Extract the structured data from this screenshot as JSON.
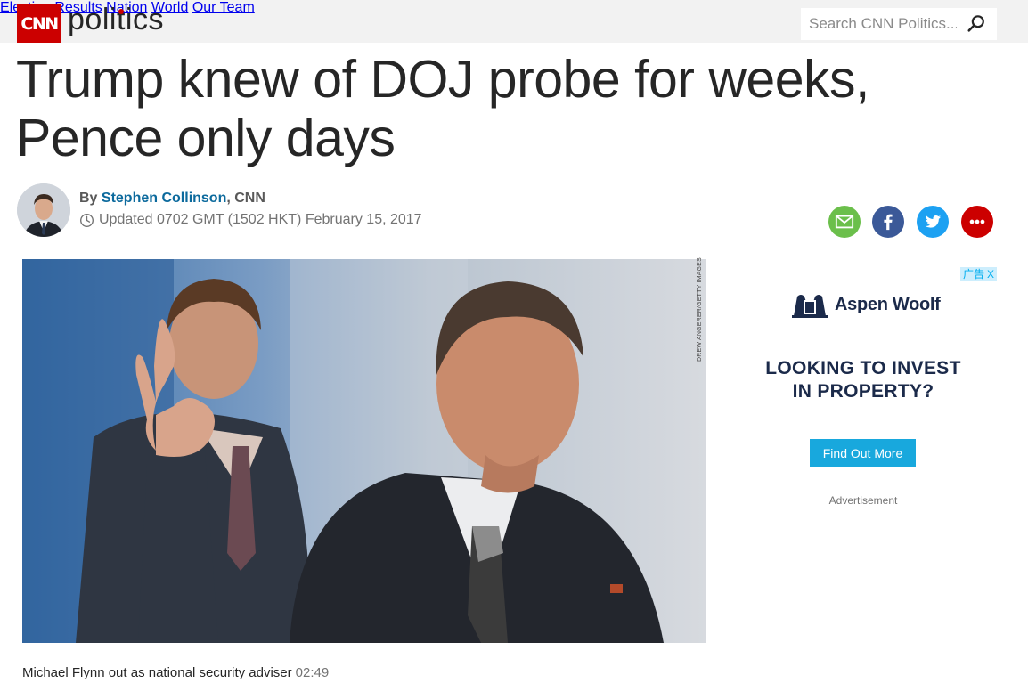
{
  "header": {
    "logo_text": "CNN",
    "section_name_pre": "poli",
    "section_name_i": "t",
    "section_name_post": "ics",
    "nav": [
      "Election Results",
      "Nation",
      "World",
      "Our Team"
    ],
    "search_placeholder": "Search CNN Politics..."
  },
  "article": {
    "headline_line1": "Trump knew of DOJ probe for weeks,",
    "headline_line2": "Pence only days",
    "by_prefix": "By ",
    "author": "Stephen Collinson",
    "outlet": ", CNN",
    "updated": "Updated 0702 GMT (1502 HKT) February 15, 2017",
    "photo_credit": "DREW ANGERER/GETTY IMAGES",
    "caption": "Michael Flynn out as national security adviser",
    "caption_duration": "02:49"
  },
  "share": {
    "icons": [
      "email-icon",
      "facebook-icon",
      "twitter-icon",
      "more-icon"
    ],
    "colors": {
      "email": "#6bbf4b",
      "facebook": "#3b5998",
      "twitter": "#1da1f2",
      "more": "#cc0000"
    }
  },
  "ad": {
    "tag": "广告",
    "close": "X",
    "brand": "Aspen Woolf",
    "headline_line1": "LOOKING TO INVEST",
    "headline_line2": "IN PROPERTY?",
    "button": "Find Out More",
    "label": "Advertisement"
  },
  "colors": {
    "brand_red": "#cc0000",
    "link_blue": "#0c6a9d",
    "ad_blue": "#18a8dd"
  }
}
